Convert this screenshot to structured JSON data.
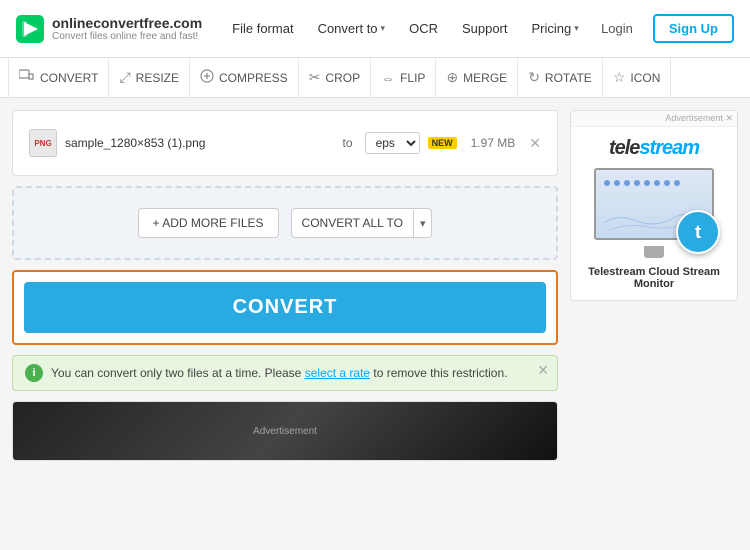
{
  "site": {
    "title": "onlineconvertfree.com",
    "subtitle": "Convert files online free and fast!"
  },
  "nav": {
    "items": [
      {
        "label": "File format",
        "hasDropdown": false
      },
      {
        "label": "Convert to",
        "hasDropdown": true
      },
      {
        "label": "OCR",
        "hasDropdown": false
      },
      {
        "label": "Support",
        "hasDropdown": false
      },
      {
        "label": "Pricing",
        "hasDropdown": true
      }
    ],
    "login": "Login",
    "signup": "Sign Up"
  },
  "toolbar": {
    "items": [
      {
        "icon": "↔",
        "label": "CONVERT"
      },
      {
        "icon": "⤢",
        "label": "RESIZE"
      },
      {
        "icon": "⊖",
        "label": "COMPRESS"
      },
      {
        "icon": "✂",
        "label": "CROP"
      },
      {
        "icon": "⤡",
        "label": "FLIP"
      },
      {
        "icon": "⊕",
        "label": "MERGE"
      },
      {
        "icon": "↻",
        "label": "ROTATE"
      },
      {
        "icon": "☆",
        "label": "ICON"
      }
    ]
  },
  "filePanel": {
    "file": {
      "name": "sample_1280×853 (1).png",
      "format": "eps",
      "badge": "NEW",
      "size": "1.97 MB"
    },
    "addFilesLabel": "+ ADD MORE FILES",
    "convertAllLabel": "CONVERT ALL TO",
    "convertLabel": "CONVERT"
  },
  "infoBanner": {
    "text": "You can convert only two files at a time. Please ",
    "linkText": "select a rate",
    "textAfter": " to remove this restriction."
  },
  "ad": {
    "label": "Advertisement",
    "brand": "telestream",
    "caption": "Telestream Cloud Stream Monitor",
    "badge": "t"
  }
}
